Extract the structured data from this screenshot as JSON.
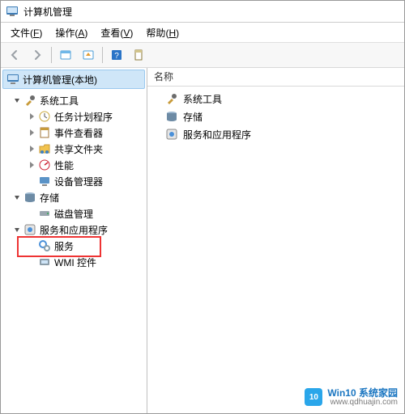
{
  "window": {
    "title": "计算机管理"
  },
  "menu": {
    "file": {
      "label": "文件",
      "accel": "F"
    },
    "action": {
      "label": "操作",
      "accel": "A"
    },
    "view": {
      "label": "查看",
      "accel": "V"
    },
    "help": {
      "label": "帮助",
      "accel": "H"
    }
  },
  "toolbar": {
    "back": "后退",
    "forward": "前进",
    "up": "向上",
    "show": "显示",
    "prop": "属性",
    "refresh": "刷新"
  },
  "tree": {
    "root": "计算机管理(本地)",
    "system_tools": "系统工具",
    "task_scheduler": "任务计划程序",
    "event_viewer": "事件查看器",
    "shared_folders": "共享文件夹",
    "performance": "性能",
    "device_manager": "设备管理器",
    "storage": "存储",
    "disk_management": "磁盘管理",
    "services_apps": "服务和应用程序",
    "services": "服务",
    "wmi": "WMI 控件"
  },
  "list": {
    "header_name": "名称",
    "items": {
      "system_tools": "系统工具",
      "storage": "存储",
      "services_apps": "服务和应用程序"
    }
  },
  "watermark": {
    "logo": "10",
    "title": "Win10 系统家园",
    "url": "www.qdhuajin.com"
  }
}
